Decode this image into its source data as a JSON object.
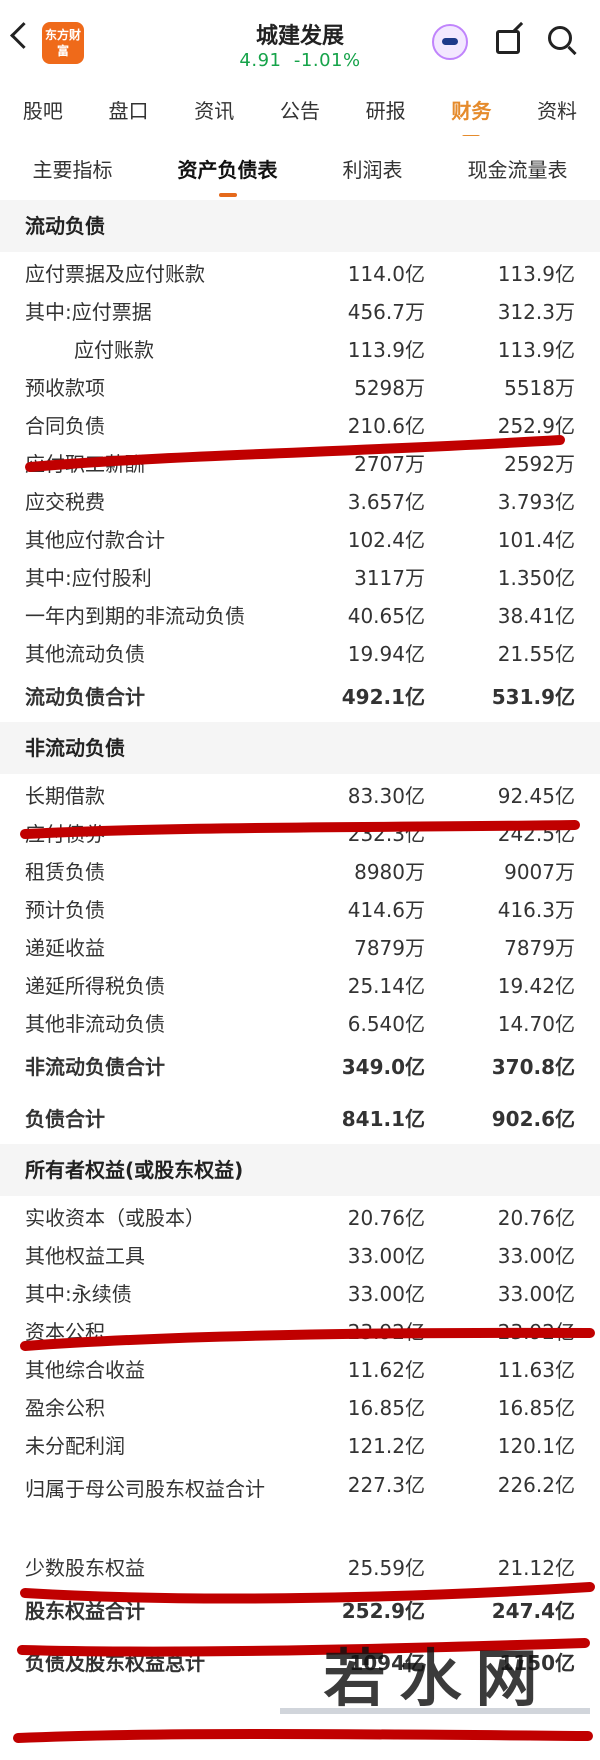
{
  "header": {
    "logo_text": "东方财富",
    "stock_name": "城建发展",
    "price": "4.91",
    "change": "-1.01%"
  },
  "tabs": [
    "股吧",
    "盘口",
    "资讯",
    "公告",
    "研报",
    "财务",
    "资料"
  ],
  "subtabs": [
    "主要指标",
    "资产负债表",
    "利润表",
    "现金流量表"
  ],
  "sections": [
    {
      "title": "流动负债",
      "rows": [
        [
          "应付票据及应付账款",
          "114.0亿",
          "113.9亿"
        ],
        [
          "其中:应付票据",
          "456.7万",
          "312.3万"
        ],
        [
          "应付账款",
          "113.9亿",
          "113.9亿"
        ],
        [
          "预收款项",
          "5298万",
          "5518万"
        ],
        [
          "合同负债",
          "210.6亿",
          "252.9亿"
        ],
        [
          "应付职工薪酬",
          "2707万",
          "2592万"
        ],
        [
          "应交税费",
          "3.657亿",
          "3.793亿"
        ],
        [
          "其他应付款合计",
          "102.4亿",
          "101.4亿"
        ],
        [
          "其中:应付股利",
          "3117万",
          "1.350亿"
        ],
        [
          "一年内到期的非流动负债",
          "40.65亿",
          "38.41亿"
        ],
        [
          "其他流动负债",
          "19.94亿",
          "21.55亿"
        ]
      ],
      "total": [
        "流动负债合计",
        "492.1亿",
        "531.9亿"
      ]
    },
    {
      "title": "非流动负债",
      "rows": [
        [
          "长期借款",
          "83.30亿",
          "92.45亿"
        ],
        [
          "应付债券",
          "232.3亿",
          "242.5亿"
        ],
        [
          "租赁负债",
          "8980万",
          "9007万"
        ],
        [
          "预计负债",
          "414.6万",
          "416.3万"
        ],
        [
          "递延收益",
          "7879万",
          "7879万"
        ],
        [
          "递延所得税负债",
          "25.14亿",
          "19.42亿"
        ],
        [
          "其他非流动负债",
          "6.540亿",
          "14.70亿"
        ]
      ],
      "totals": [
        [
          "非流动负债合计",
          "349.0亿",
          "370.8亿"
        ],
        [
          "负债合计",
          "841.1亿",
          "902.6亿"
        ]
      ]
    },
    {
      "title": "所有者权益(或股东权益)",
      "rows": [
        [
          "实收资本（或股本）",
          "20.76亿",
          "20.76亿"
        ],
        [
          "其他权益工具",
          "33.00亿",
          "33.00亿"
        ],
        [
          "其中:永续债",
          "33.00亿",
          "33.00亿"
        ],
        [
          "资本公积",
          "23.92亿",
          "23.92亿"
        ],
        [
          "其他综合收益",
          "11.62亿",
          "11.63亿"
        ],
        [
          "盈余公积",
          "16.85亿",
          "16.85亿"
        ],
        [
          "未分配利润",
          "121.2亿",
          "120.1亿"
        ]
      ],
      "parent_total": [
        "归属于母公司股东权益合计",
        "227.3亿",
        "226.2亿"
      ],
      "minority": [
        "少数股东权益",
        "25.59亿",
        "21.12亿"
      ],
      "equity_total": [
        "股东权益合计",
        "252.9亿",
        "247.4亿"
      ],
      "grand_total": [
        "负债及股东权益总计",
        "1094亿",
        "1150亿"
      ]
    }
  ],
  "watermark": "若水网",
  "colors": {
    "accent": "#e58b2c",
    "price_change": "#16a34a",
    "markup_red": "#c00000"
  }
}
